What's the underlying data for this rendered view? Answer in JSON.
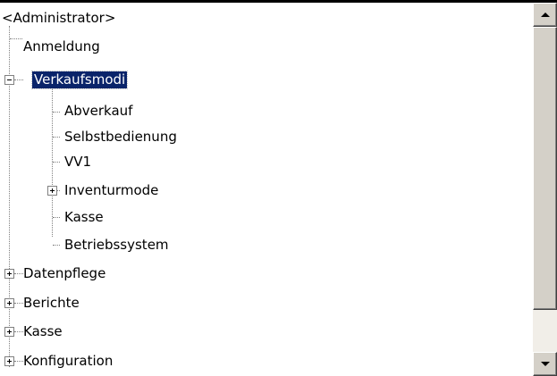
{
  "tree": {
    "root": {
      "label": "<Administrator>"
    },
    "items": [
      {
        "label": "Anmeldung"
      },
      {
        "label": "Verkaufsmodi",
        "expanded": true,
        "selected": true
      },
      {
        "label": "Abverkauf"
      },
      {
        "label": "Selbstbedienung"
      },
      {
        "label": "VV1"
      },
      {
        "label": "Inventurmode",
        "expanded": false
      },
      {
        "label": "Kasse"
      },
      {
        "label": "Betriebssystem"
      },
      {
        "label": "Datenpflege",
        "expanded": false
      },
      {
        "label": "Berichte",
        "expanded": false
      },
      {
        "label": "Kasse",
        "expanded": false
      },
      {
        "label": "Konfiguration",
        "expanded": false
      }
    ]
  },
  "colors": {
    "selection": "#0a246a",
    "scrollbar": "#d4d0c8"
  }
}
